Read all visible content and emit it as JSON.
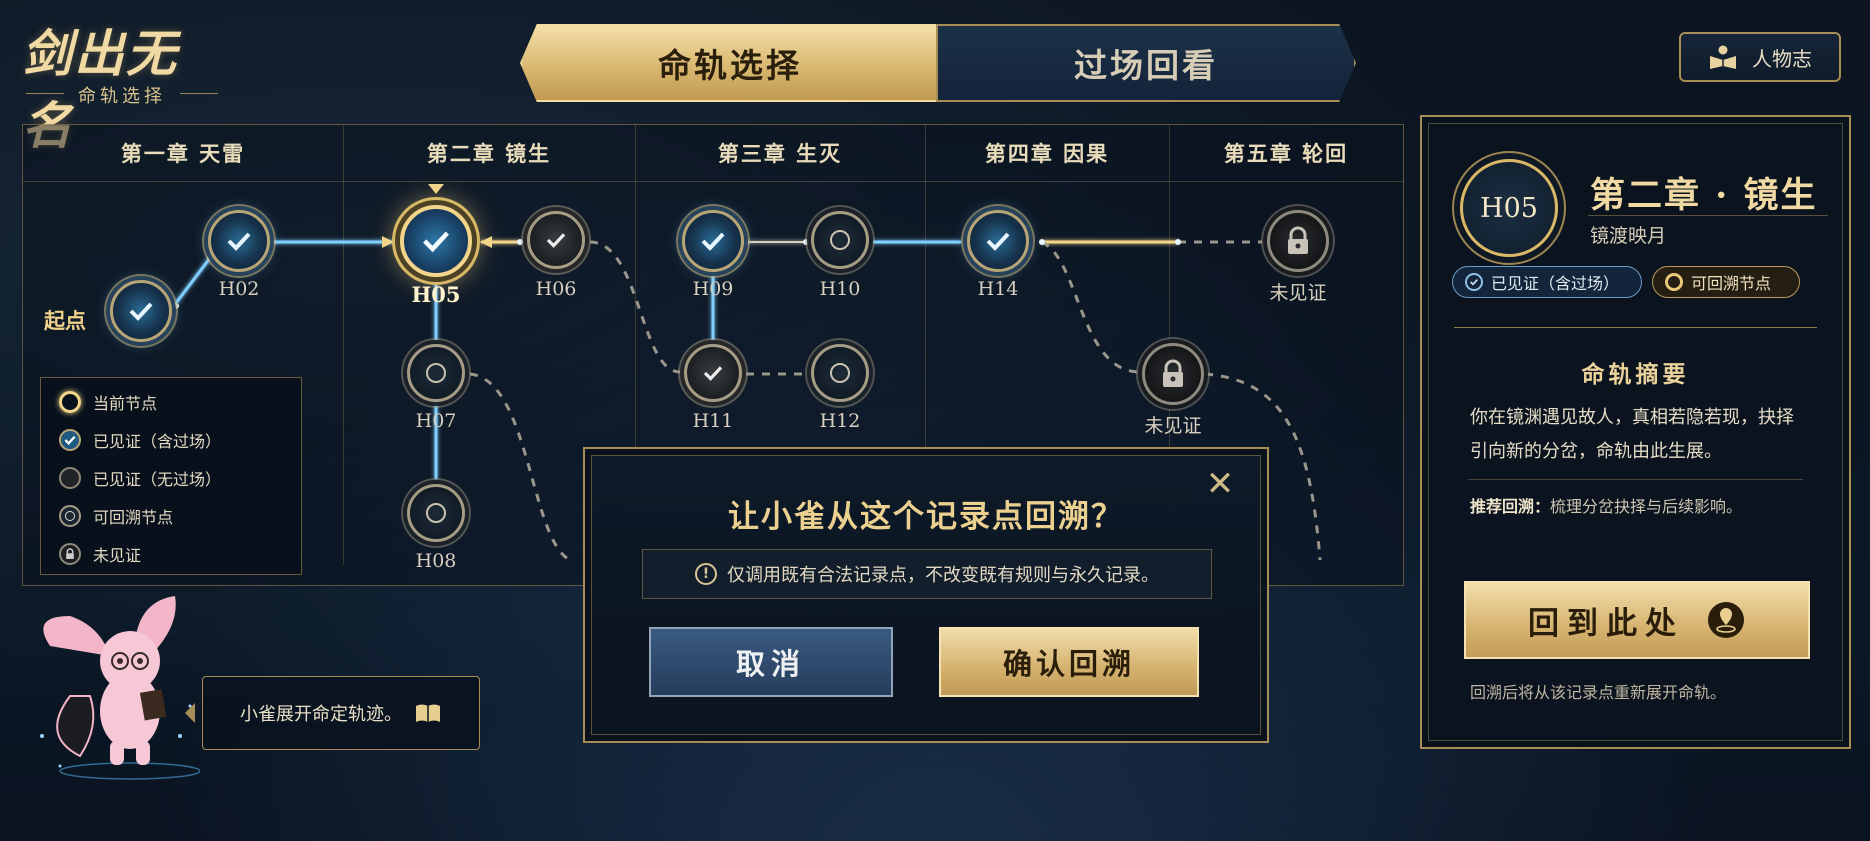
{
  "logo": {
    "title": "剑出无名",
    "subtitle": "命轨选择"
  },
  "tabs": [
    {
      "label": "命轨选择",
      "active": true
    },
    {
      "label": "过场回看",
      "active": false
    }
  ],
  "character_button": {
    "label": "人物志",
    "icon": "book-person-icon"
  },
  "chapters": [
    "第一章  天雷",
    "第二章  镜生",
    "第三章  生灭",
    "第四章  因果",
    "第五章  轮回"
  ],
  "start_label": "起点",
  "nodes": [
    {
      "id": "H02",
      "state": "seen"
    },
    {
      "id": "H05",
      "state": "current"
    },
    {
      "id": "H06",
      "state": "seen-no-cutscene"
    },
    {
      "id": "H07",
      "state": "rewindable"
    },
    {
      "id": "H08",
      "state": "rewindable"
    },
    {
      "id": "H09",
      "state": "seen"
    },
    {
      "id": "H10",
      "state": "rewindable"
    },
    {
      "id": "H11",
      "state": "seen-no-cutscene"
    },
    {
      "id": "H12",
      "state": "rewindable"
    },
    {
      "id": "H14",
      "state": "seen"
    }
  ],
  "locked_label": "未见证",
  "legend": [
    {
      "label": "当前节点",
      "icon": "current-node-icon"
    },
    {
      "label": "已见证（含过场）",
      "icon": "check-icon"
    },
    {
      "label": "已见证（无过场）",
      "icon": "dark-node-icon"
    },
    {
      "label": "可回溯节点",
      "icon": "ring-icon"
    },
    {
      "label": "未见证",
      "icon": "lock-icon"
    }
  ],
  "companion": {
    "speech": "小雀展开命定轨迹。",
    "icon": "open-book-icon"
  },
  "dialog": {
    "title": "让小雀从这个记录点回溯？",
    "note": "仅调用既有合法记录点，不改变既有规则与永久记录。",
    "note_icon": "!",
    "cancel_label": "取消",
    "confirm_label": "确认回溯"
  },
  "detail": {
    "node_id": "H05",
    "title": "第二章 · 镜生",
    "subtitle": "镜渡映月",
    "badge_seen": "已见证（含过场）",
    "badge_rewind": "可回溯节点",
    "summary_heading": "命轨摘要",
    "summary_body": "你在镜渊遇见故人，真相若隐若现，抉择引向新的分岔，命轨由此生展。",
    "recommend_label": "推荐回溯：",
    "recommend_text": "梳理分岔抉择与后续影响。",
    "return_button": "回到此处",
    "footer": "回溯后将从该记录点重新展开命轨。"
  },
  "colors": {
    "gold": "#e7c77f",
    "seen_blue": "#6ec3f0",
    "panel": "#0a1320",
    "cancel_blue": "#2f4b6d"
  }
}
